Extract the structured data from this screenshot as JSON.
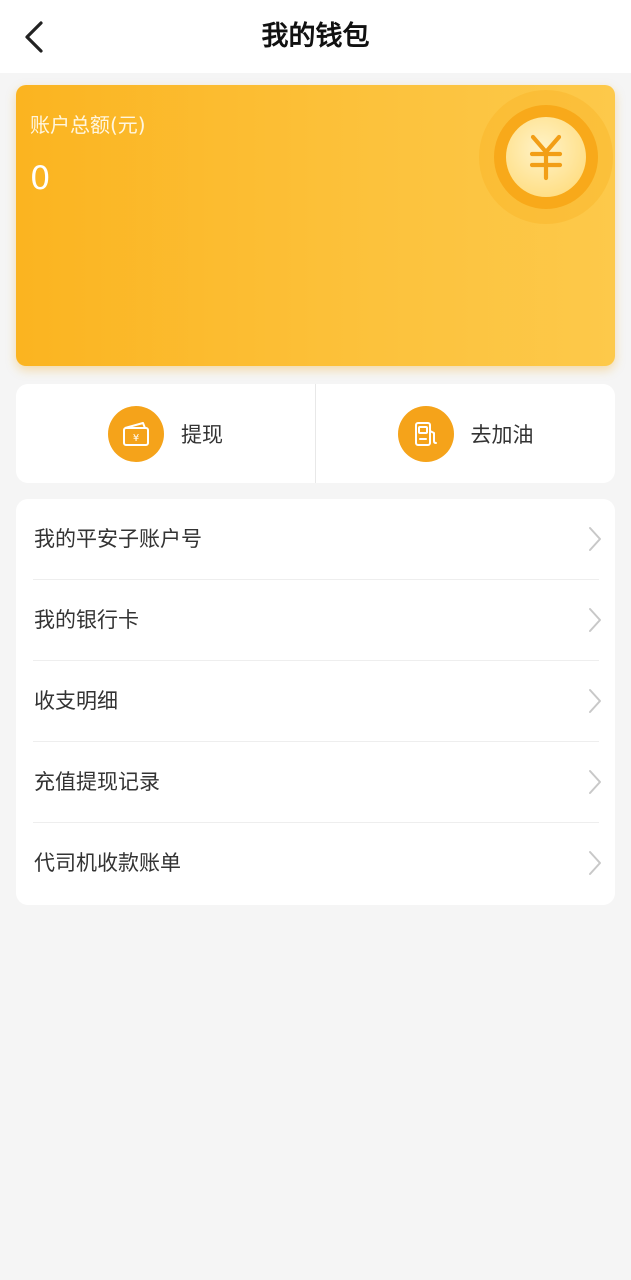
{
  "header": {
    "title": "我的钱包",
    "back_icon": "chevron-left-icon"
  },
  "balance": {
    "label": "账户总额(元)",
    "value": "0",
    "coin_icon": "yuan-coin-icon"
  },
  "actions": [
    {
      "label": "提现",
      "icon": "wallet-yuan-icon"
    },
    {
      "label": "去加油",
      "icon": "fuel-pump-icon"
    }
  ],
  "menu": {
    "items": [
      {
        "label": "我的平安子账户号"
      },
      {
        "label": "我的银行卡"
      },
      {
        "label": "收支明细"
      },
      {
        "label": "充值提现记录"
      },
      {
        "label": "代司机收款账单"
      }
    ]
  },
  "colors": {
    "accent": "#f5a31a",
    "card_gradient_start": "#fbb420",
    "card_gradient_end": "#fdc94a",
    "background": "#f5f5f5"
  }
}
